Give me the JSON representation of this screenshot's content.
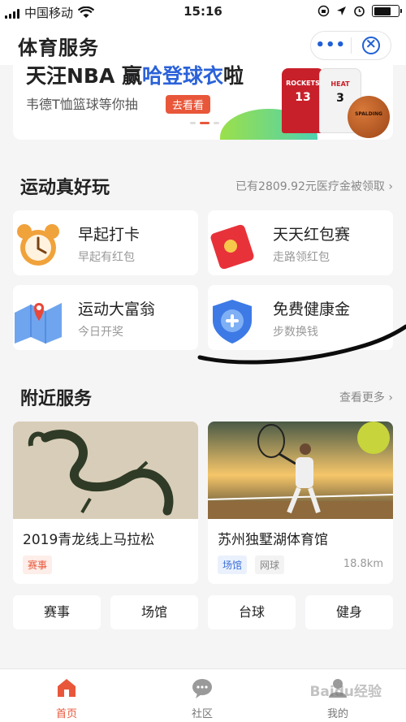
{
  "status_bar": {
    "carrier": "中国移动",
    "time": "15:16"
  },
  "navbar": {
    "title": "体育服务",
    "more_label": "•••"
  },
  "banner": {
    "headline_prefix": "天汪NBA 赢",
    "headline_highlight": "哈登球衣",
    "headline_suffix": "啦",
    "subtitle": "韦德T恤篮球等你抽",
    "cta": "去看看",
    "jersey_red_team": "ROCKETS",
    "jersey_red_number": "13",
    "jersey_white_team": "HEAT",
    "jersey_white_number": "3",
    "ball_brand": "SPALDING"
  },
  "fun": {
    "title": "运动真好玩",
    "more": "已有2809.92元医疗金被领取",
    "items": [
      {
        "title": "早起打卡",
        "desc": "早起有红包",
        "icon": "alarm-clock-icon"
      },
      {
        "title": "天天红包赛",
        "desc": "走路领红包",
        "icon": "red-envelope-icon"
      },
      {
        "title": "运动大富翁",
        "desc": "今日开奖",
        "icon": "map-pin-icon"
      },
      {
        "title": "免费健康金",
        "desc": "步数换钱",
        "icon": "health-shield-icon"
      }
    ]
  },
  "nearby": {
    "title": "附近服务",
    "more": "查看更多",
    "items": [
      {
        "name": "2019青龙线上马拉松",
        "tags": [
          "赛事"
        ],
        "distance": ""
      },
      {
        "name": "苏州独墅湖体育馆",
        "tags": [
          "场馆",
          "网球"
        ],
        "distance": "18.8km"
      }
    ]
  },
  "categories": [
    "赛事",
    "场馆",
    "台球",
    "健身"
  ],
  "tabbar": {
    "items": [
      {
        "label": "首页",
        "icon": "home-icon"
      },
      {
        "label": "社区",
        "icon": "chat-bubble-icon"
      },
      {
        "label": "我的",
        "icon": "user-icon"
      }
    ]
  },
  "watermark": "Baidu经验",
  "colors": {
    "accent": "#e8573a",
    "brand_blue": "#2b62d9",
    "nav_blue": "#1f5fd6"
  }
}
